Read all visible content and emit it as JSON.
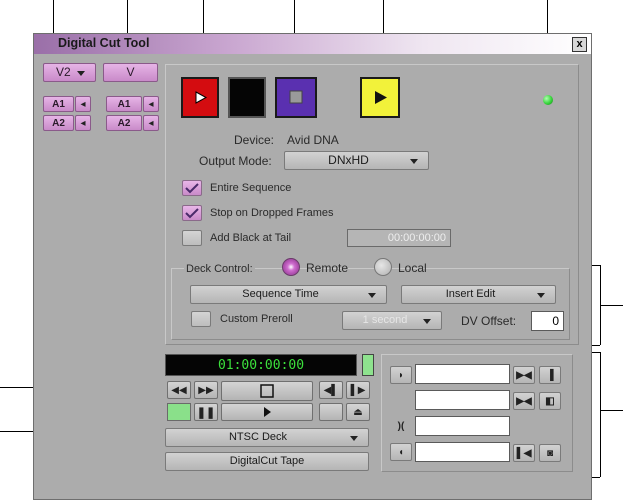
{
  "window": {
    "title": "Digital Cut Tool",
    "close_label": "x"
  },
  "tracks": {
    "video_dropdown_label": "V2",
    "video_button_label": "V",
    "audio_left": [
      {
        "label": "A1"
      },
      {
        "label": "A2"
      }
    ],
    "audio_right": [
      {
        "label": "A1"
      },
      {
        "label": "A2"
      }
    ]
  },
  "transport": {
    "record_icon": "play-icon",
    "stop_icon": "stop-icon",
    "preview_icon": "square-icon",
    "play_icon": "play-icon",
    "record_color": "#d40c10",
    "preview_color": "#5a30b0",
    "play_color": "#f2f23a",
    "status_led_color": "#36d43a"
  },
  "device": {
    "label": "Device:",
    "value": "Avid DNA"
  },
  "output_mode": {
    "label": "Output Mode:",
    "value": "DNxHD"
  },
  "options": {
    "entire_sequence": {
      "label": "Entire Sequence",
      "checked": true
    },
    "stop_dropped": {
      "label": "Stop on Dropped Frames",
      "checked": true
    },
    "add_black": {
      "label": "Add Black at Tail",
      "checked": false,
      "value": "00:00:00:00"
    }
  },
  "deck_control": {
    "label": "Deck Control:",
    "remote_label": "Remote",
    "local_label": "Local",
    "selected": "Remote",
    "sequence_time_label": "Sequence Time",
    "insert_edit_label": "Insert Edit",
    "custom_preroll_label": "Custom Preroll",
    "preroll_value": "1 second",
    "dv_offset_label": "DV Offset:",
    "dv_offset_value": "0"
  },
  "deck": {
    "timecode": "01:00:00:00",
    "name": "NTSC Deck",
    "tape_label": "DigitalCut Tape"
  }
}
